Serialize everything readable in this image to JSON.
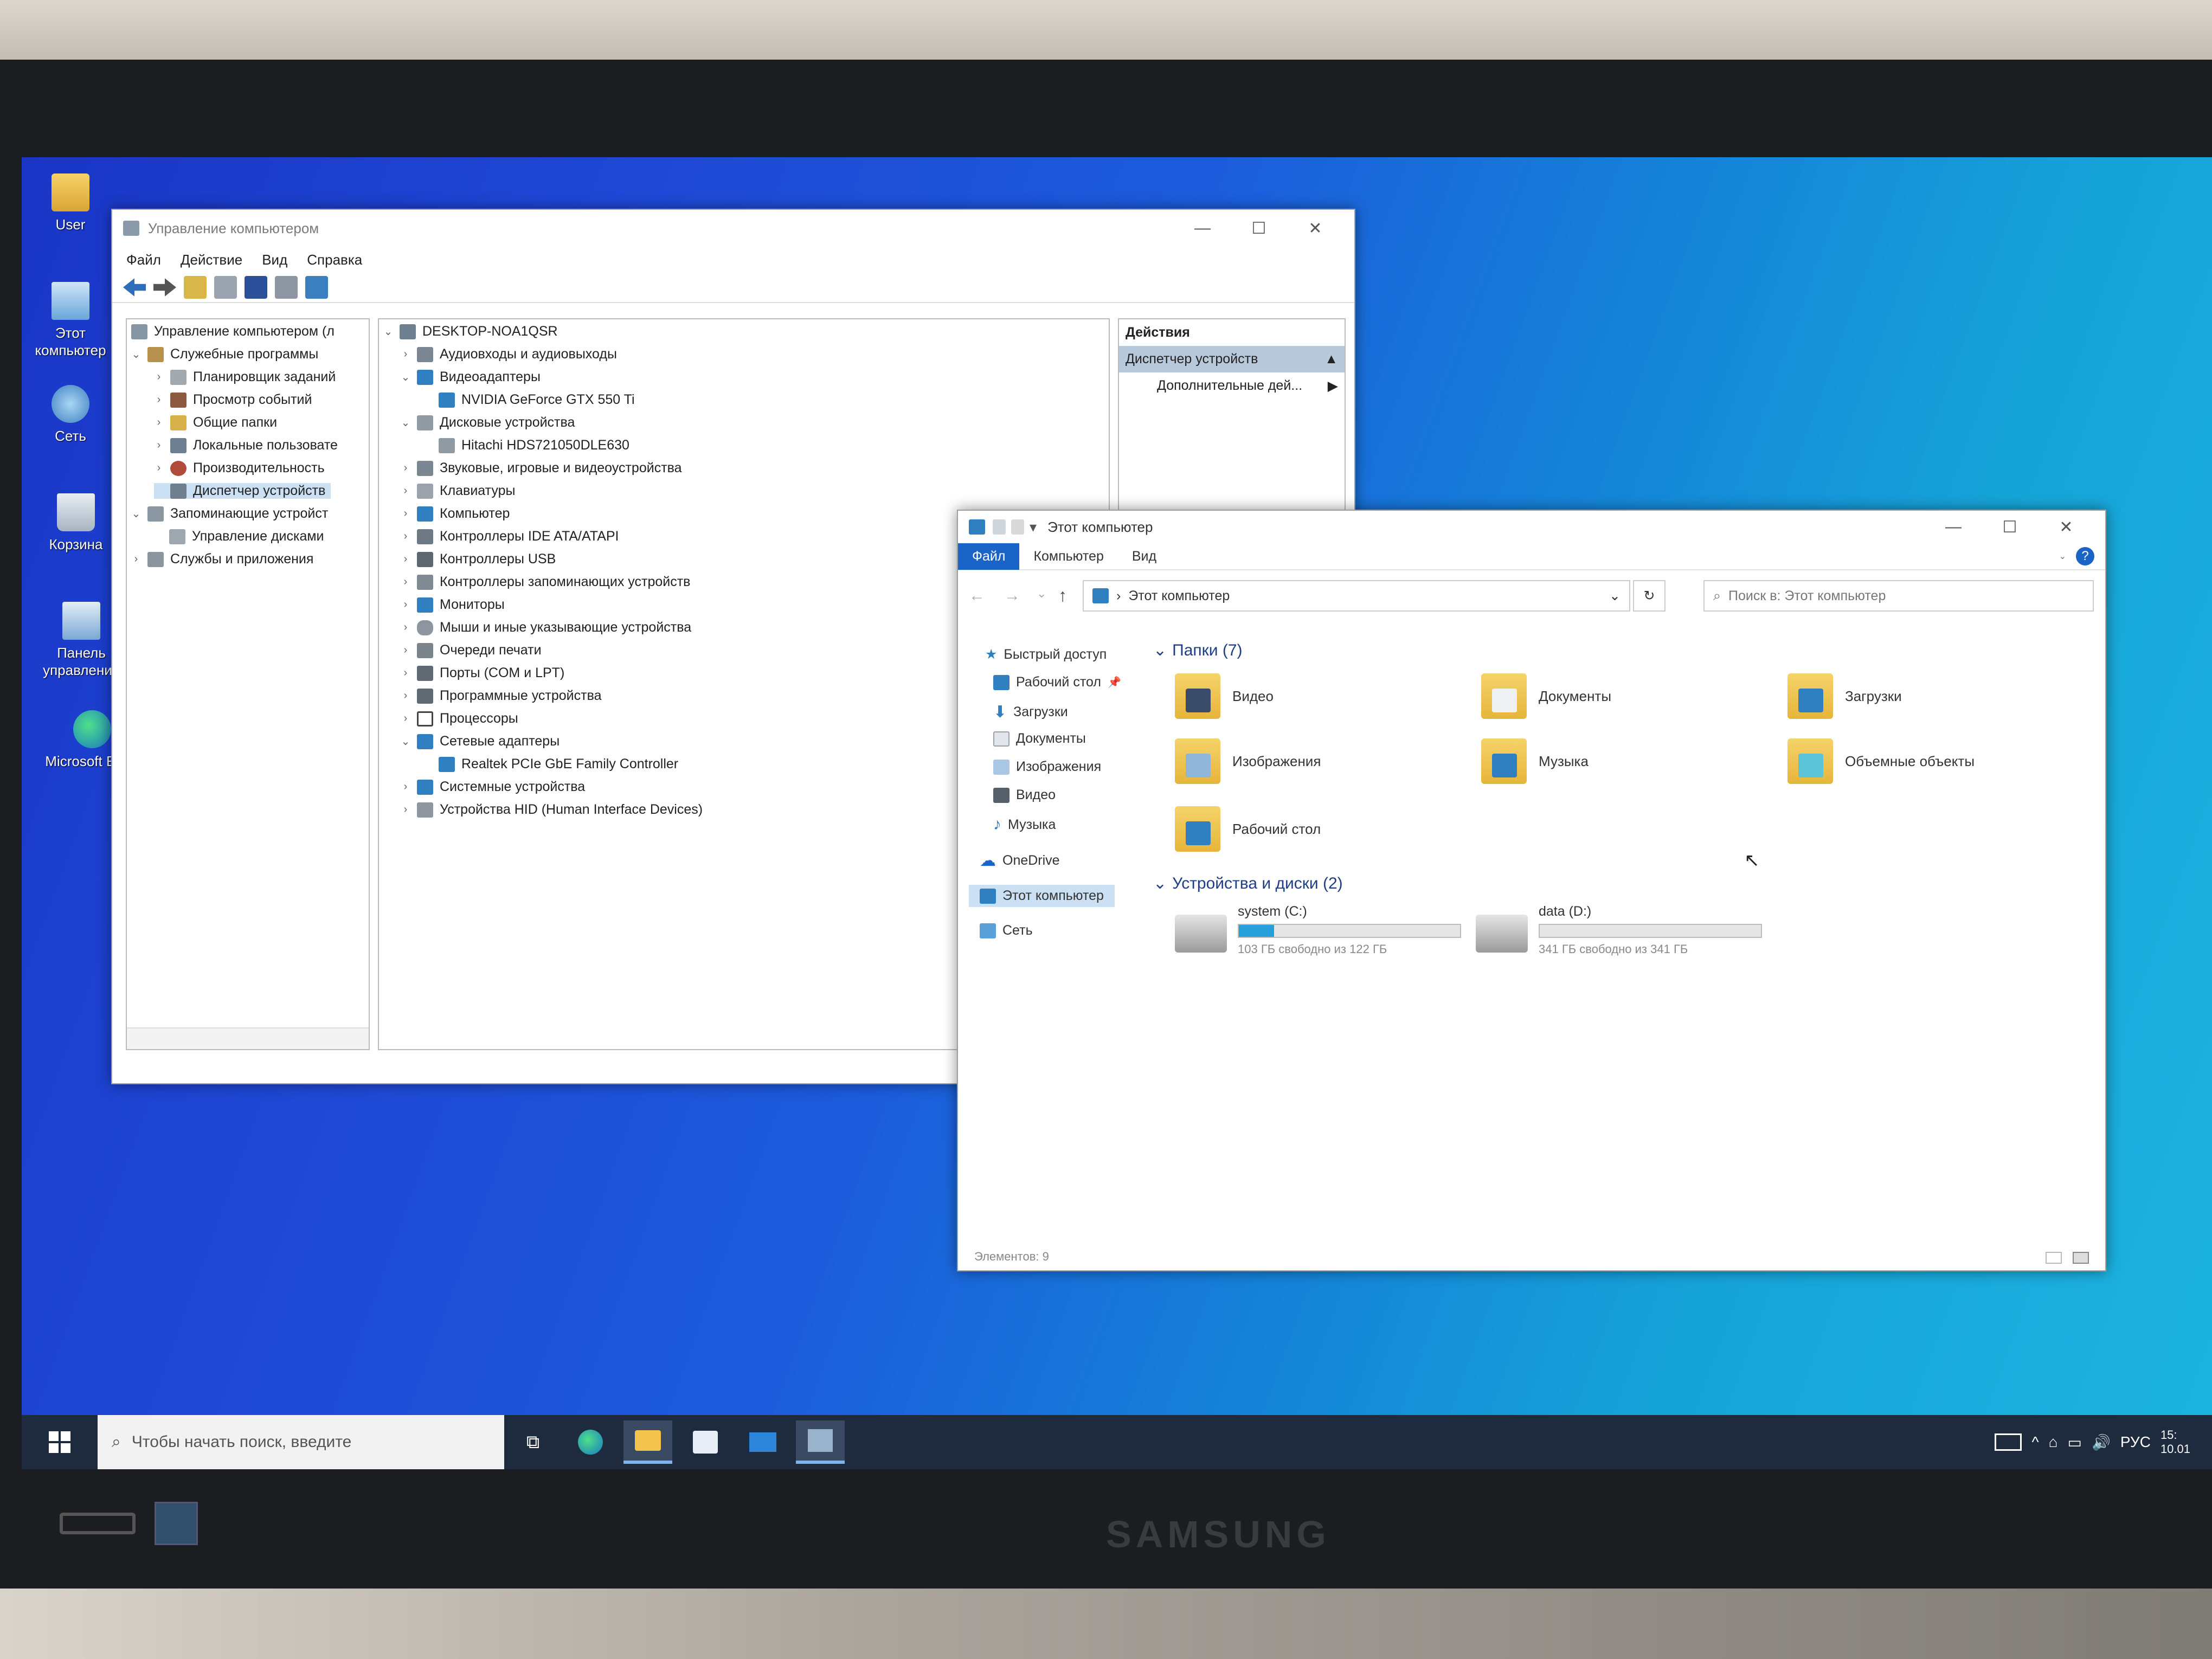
{
  "desktop": {
    "icons": [
      {
        "label": "User"
      },
      {
        "label": "Этот компьютер"
      },
      {
        "label": "Сеть"
      },
      {
        "label": "Корзина"
      },
      {
        "label": "Панель управления"
      },
      {
        "label": "Microsoft Edge"
      }
    ]
  },
  "mmc": {
    "title": "Управление компьютером",
    "menu": [
      "Файл",
      "Действие",
      "Вид",
      "Справка"
    ],
    "left_tree": [
      {
        "label": "Управление компьютером (л"
      },
      {
        "label": "Служебные программы"
      },
      {
        "label": "Планировщик заданий"
      },
      {
        "label": "Просмотр событий"
      },
      {
        "label": "Общие папки"
      },
      {
        "label": "Локальные пользовате"
      },
      {
        "label": "Производительность"
      },
      {
        "label": "Диспетчер устройств"
      },
      {
        "label": "Запоминающие устройст"
      },
      {
        "label": "Управление дисками"
      },
      {
        "label": "Службы и приложения"
      }
    ],
    "devices": [
      {
        "label": "DESKTOP-NOA1QSR"
      },
      {
        "label": "Аудиовходы и аудиовыходы"
      },
      {
        "label": "Видеоадаптеры"
      },
      {
        "label": "NVIDIA GeForce GTX 550 Ti"
      },
      {
        "label": "Дисковые устройства"
      },
      {
        "label": "Hitachi HDS721050DLE630"
      },
      {
        "label": "Звуковые, игровые и видеоустройства"
      },
      {
        "label": "Клавиатуры"
      },
      {
        "label": "Компьютер"
      },
      {
        "label": "Контроллеры IDE ATA/ATAPI"
      },
      {
        "label": "Контроллеры USB"
      },
      {
        "label": "Контроллеры запоминающих устройств"
      },
      {
        "label": "Мониторы"
      },
      {
        "label": "Мыши и иные указывающие устройства"
      },
      {
        "label": "Очереди печати"
      },
      {
        "label": "Порты (COM и LPT)"
      },
      {
        "label": "Программные устройства"
      },
      {
        "label": "Процессоры"
      },
      {
        "label": "Сетевые адаптеры"
      },
      {
        "label": "Realtek PCIe GbE Family Controller"
      },
      {
        "label": "Системные устройства"
      },
      {
        "label": "Устройства HID (Human Interface Devices)"
      }
    ],
    "actions": {
      "header": "Действия",
      "selected": "Диспетчер устройств",
      "more": "Дополнительные дей..."
    }
  },
  "explorer": {
    "title": "Этот компьютер",
    "tabs": [
      "Файл",
      "Компьютер",
      "Вид"
    ],
    "address": "Этот компьютер",
    "search_placeholder": "Поиск в: Этот компьютер",
    "nav": [
      {
        "label": "Быстрый доступ"
      },
      {
        "label": "Рабочий стол"
      },
      {
        "label": "Загрузки"
      },
      {
        "label": "Документы"
      },
      {
        "label": "Изображения"
      },
      {
        "label": "Видео"
      },
      {
        "label": "Музыка"
      },
      {
        "label": "OneDrive"
      },
      {
        "label": "Этот компьютер"
      },
      {
        "label": "Сеть"
      }
    ],
    "folders_header": "Папки (7)",
    "folders": [
      {
        "label": "Видео"
      },
      {
        "label": "Документы"
      },
      {
        "label": "Загрузки"
      },
      {
        "label": "Изображения"
      },
      {
        "label": "Музыка"
      },
      {
        "label": "Объемные объекты"
      },
      {
        "label": "Рабочий стол"
      }
    ],
    "devices_header": "Устройства и диски (2)",
    "drives": [
      {
        "name": "system (C:)",
        "free": "103 ГБ свободно из 122 ГБ",
        "used_fraction": 0.16
      },
      {
        "name": "data (D:)",
        "free": "341 ГБ свободно из 341 ГБ",
        "used_fraction": 0.0
      }
    ],
    "status": "Элементов: 9"
  },
  "taskbar": {
    "search_placeholder": "Чтобы начать поиск, введите",
    "lang": "РУС",
    "clock": "15:",
    "date": "10.01"
  },
  "monitor": {
    "brand": "SAMSUNG"
  },
  "colors": {
    "accent": "#1a64c8",
    "desktop": "#1c5cdc",
    "taskbar": "#1e2a3e"
  }
}
